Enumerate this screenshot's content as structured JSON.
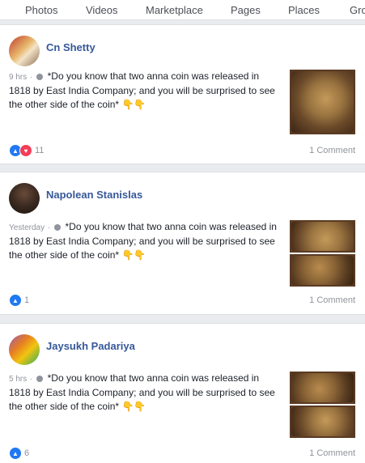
{
  "tabs": [
    "Photos",
    "Videos",
    "Marketplace",
    "Pages",
    "Places",
    "Gro"
  ],
  "posts": [
    {
      "author": "Cn Shetty",
      "time": "9 hrs",
      "sep": "·",
      "text": "*Do you know that two anna coin was released in 1818 by East India Company; and you will be surprised to see the other side of the coin*",
      "emoji": "👇👇",
      "reaction_count": "11",
      "comments": "1 Comment"
    },
    {
      "author": "Napolean Stanislas",
      "time": "Yesterday",
      "sep": "·",
      "text": "*Do you know that two anna coin was released in 1818 by East India Company; and you will be surprised to see the other side of the coin*",
      "emoji": "👇👇",
      "reaction_count": "1",
      "comments": "1 Comment"
    },
    {
      "author": "Jaysukh Padariya",
      "time": "5 hrs",
      "sep": "·",
      "text": "*Do you know that two anna coin was released in 1818 by East India Company; and you will be surprised to see the other side of the coin*",
      "emoji": "👇👇",
      "reaction_count": "6",
      "comments": "1 Comment"
    }
  ],
  "colors": {
    "link": "#365899",
    "meta": "#90949c",
    "like": "#2078f4",
    "love": "#f33e58",
    "background": "#e9ebee"
  },
  "icons": [
    "globe-icon",
    "like-reaction-icon",
    "love-reaction-icon"
  ]
}
